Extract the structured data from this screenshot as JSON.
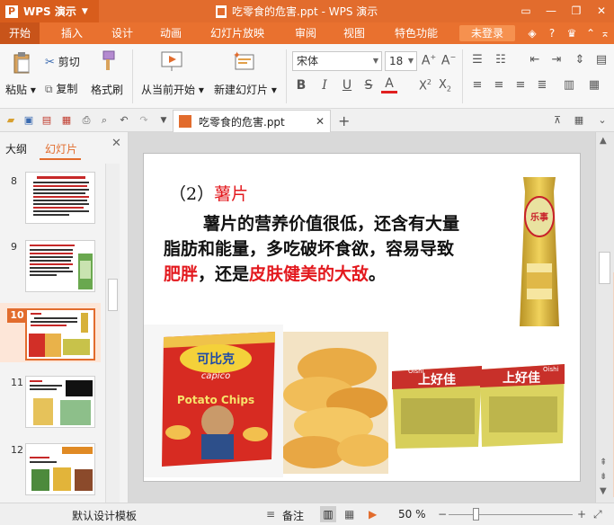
{
  "app": {
    "name": "WPS 演示",
    "title": "吃零食的危害.ppt - WPS 演示"
  },
  "menu": {
    "tabs": [
      "开始",
      "插入",
      "设计",
      "动画",
      "幻灯片放映",
      "审阅",
      "视图",
      "特色功能"
    ],
    "active_tab": "开始",
    "login": "未登录"
  },
  "ribbon": {
    "paste": "粘贴",
    "cut": "剪切",
    "copy": "复制",
    "format_painter": "格式刷",
    "from_current": "从当前开始",
    "new_slide": "新建幻灯片",
    "font_name": "宋体",
    "font_size": "18"
  },
  "document": {
    "tab_name": "吃零食的危害.ppt"
  },
  "left_panel": {
    "tab_outline": "大纲",
    "tab_slides": "幻灯片",
    "thumbnails": [
      "8",
      "9",
      "10",
      "11",
      "12"
    ],
    "selected": "10"
  },
  "slide": {
    "heading_prefix": "（2）",
    "heading_red": "薯片",
    "body_line1": "薯片的营养价值很低，还含有大量",
    "body_line2": "脂肪和能量，多吃破坏食欲，容易导致",
    "body_red1": "肥胖",
    "body_mid": "，还是",
    "body_red2": "皮肤健美的大敌",
    "body_end": "。",
    "image_labels": {
      "bag1_brand": "可比克",
      "bag1_en": "capico",
      "bag1_chips": "Potato Chips",
      "bag2_brand": "上好佳",
      "bag2_small": "Oishi",
      "standing_bag": "乐事"
    }
  },
  "status": {
    "template": "默认设计模板",
    "notes": "备注",
    "zoom": "50 %"
  },
  "colors": {
    "accent": "#e26c2d",
    "heading_red": "#e3191e"
  }
}
